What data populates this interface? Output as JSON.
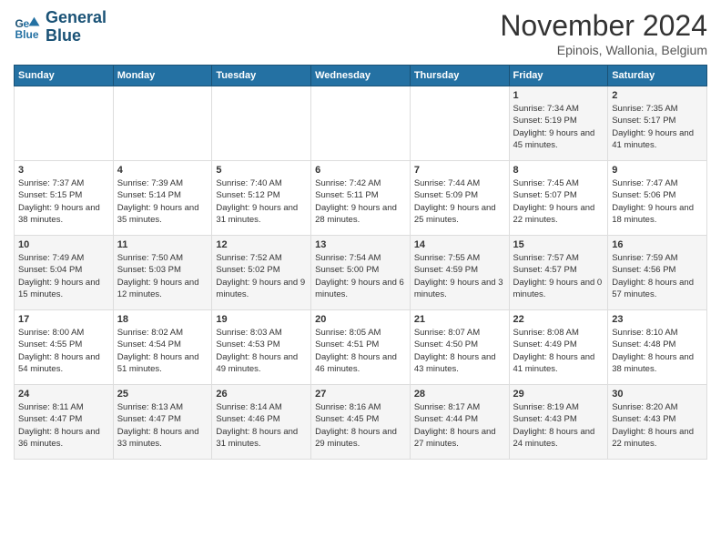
{
  "header": {
    "logo_line1": "General",
    "logo_line2": "Blue",
    "month": "November 2024",
    "location": "Epinois, Wallonia, Belgium"
  },
  "weekdays": [
    "Sunday",
    "Monday",
    "Tuesday",
    "Wednesday",
    "Thursday",
    "Friday",
    "Saturday"
  ],
  "weeks": [
    [
      {
        "day": "",
        "info": ""
      },
      {
        "day": "",
        "info": ""
      },
      {
        "day": "",
        "info": ""
      },
      {
        "day": "",
        "info": ""
      },
      {
        "day": "",
        "info": ""
      },
      {
        "day": "1",
        "info": "Sunrise: 7:34 AM\nSunset: 5:19 PM\nDaylight: 9 hours and 45 minutes."
      },
      {
        "day": "2",
        "info": "Sunrise: 7:35 AM\nSunset: 5:17 PM\nDaylight: 9 hours and 41 minutes."
      }
    ],
    [
      {
        "day": "3",
        "info": "Sunrise: 7:37 AM\nSunset: 5:15 PM\nDaylight: 9 hours and 38 minutes."
      },
      {
        "day": "4",
        "info": "Sunrise: 7:39 AM\nSunset: 5:14 PM\nDaylight: 9 hours and 35 minutes."
      },
      {
        "day": "5",
        "info": "Sunrise: 7:40 AM\nSunset: 5:12 PM\nDaylight: 9 hours and 31 minutes."
      },
      {
        "day": "6",
        "info": "Sunrise: 7:42 AM\nSunset: 5:11 PM\nDaylight: 9 hours and 28 minutes."
      },
      {
        "day": "7",
        "info": "Sunrise: 7:44 AM\nSunset: 5:09 PM\nDaylight: 9 hours and 25 minutes."
      },
      {
        "day": "8",
        "info": "Sunrise: 7:45 AM\nSunset: 5:07 PM\nDaylight: 9 hours and 22 minutes."
      },
      {
        "day": "9",
        "info": "Sunrise: 7:47 AM\nSunset: 5:06 PM\nDaylight: 9 hours and 18 minutes."
      }
    ],
    [
      {
        "day": "10",
        "info": "Sunrise: 7:49 AM\nSunset: 5:04 PM\nDaylight: 9 hours and 15 minutes."
      },
      {
        "day": "11",
        "info": "Sunrise: 7:50 AM\nSunset: 5:03 PM\nDaylight: 9 hours and 12 minutes."
      },
      {
        "day": "12",
        "info": "Sunrise: 7:52 AM\nSunset: 5:02 PM\nDaylight: 9 hours and 9 minutes."
      },
      {
        "day": "13",
        "info": "Sunrise: 7:54 AM\nSunset: 5:00 PM\nDaylight: 9 hours and 6 minutes."
      },
      {
        "day": "14",
        "info": "Sunrise: 7:55 AM\nSunset: 4:59 PM\nDaylight: 9 hours and 3 minutes."
      },
      {
        "day": "15",
        "info": "Sunrise: 7:57 AM\nSunset: 4:57 PM\nDaylight: 9 hours and 0 minutes."
      },
      {
        "day": "16",
        "info": "Sunrise: 7:59 AM\nSunset: 4:56 PM\nDaylight: 8 hours and 57 minutes."
      }
    ],
    [
      {
        "day": "17",
        "info": "Sunrise: 8:00 AM\nSunset: 4:55 PM\nDaylight: 8 hours and 54 minutes."
      },
      {
        "day": "18",
        "info": "Sunrise: 8:02 AM\nSunset: 4:54 PM\nDaylight: 8 hours and 51 minutes."
      },
      {
        "day": "19",
        "info": "Sunrise: 8:03 AM\nSunset: 4:53 PM\nDaylight: 8 hours and 49 minutes."
      },
      {
        "day": "20",
        "info": "Sunrise: 8:05 AM\nSunset: 4:51 PM\nDaylight: 8 hours and 46 minutes."
      },
      {
        "day": "21",
        "info": "Sunrise: 8:07 AM\nSunset: 4:50 PM\nDaylight: 8 hours and 43 minutes."
      },
      {
        "day": "22",
        "info": "Sunrise: 8:08 AM\nSunset: 4:49 PM\nDaylight: 8 hours and 41 minutes."
      },
      {
        "day": "23",
        "info": "Sunrise: 8:10 AM\nSunset: 4:48 PM\nDaylight: 8 hours and 38 minutes."
      }
    ],
    [
      {
        "day": "24",
        "info": "Sunrise: 8:11 AM\nSunset: 4:47 PM\nDaylight: 8 hours and 36 minutes."
      },
      {
        "day": "25",
        "info": "Sunrise: 8:13 AM\nSunset: 4:47 PM\nDaylight: 8 hours and 33 minutes."
      },
      {
        "day": "26",
        "info": "Sunrise: 8:14 AM\nSunset: 4:46 PM\nDaylight: 8 hours and 31 minutes."
      },
      {
        "day": "27",
        "info": "Sunrise: 8:16 AM\nSunset: 4:45 PM\nDaylight: 8 hours and 29 minutes."
      },
      {
        "day": "28",
        "info": "Sunrise: 8:17 AM\nSunset: 4:44 PM\nDaylight: 8 hours and 27 minutes."
      },
      {
        "day": "29",
        "info": "Sunrise: 8:19 AM\nSunset: 4:43 PM\nDaylight: 8 hours and 24 minutes."
      },
      {
        "day": "30",
        "info": "Sunrise: 8:20 AM\nSunset: 4:43 PM\nDaylight: 8 hours and 22 minutes."
      }
    ]
  ]
}
